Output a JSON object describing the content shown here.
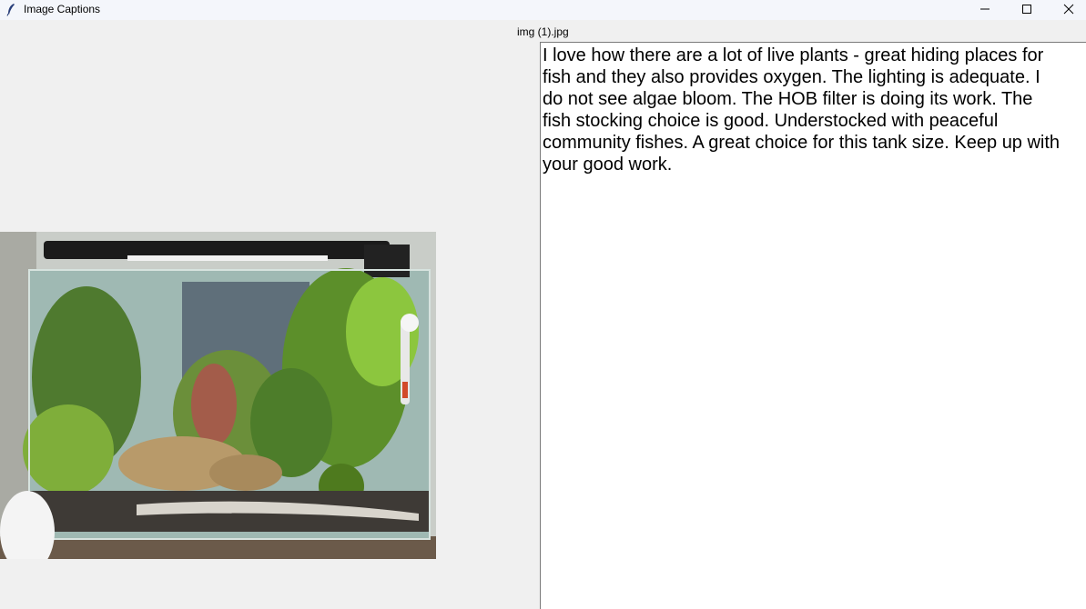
{
  "window": {
    "title": "Image Captions"
  },
  "image": {
    "filename": "img (1).jpg"
  },
  "caption": {
    "text": "I love how there are a lot of live plants - great hiding places for\nfish and they also provides oxygen. The lighting is adequate. I\ndo not see algae bloom. The HOB filter is doing its work. The\nfish stocking choice is good. Understocked with peaceful\ncommunity fishes. A great choice for this tank size. Keep up with\nyour good work."
  }
}
